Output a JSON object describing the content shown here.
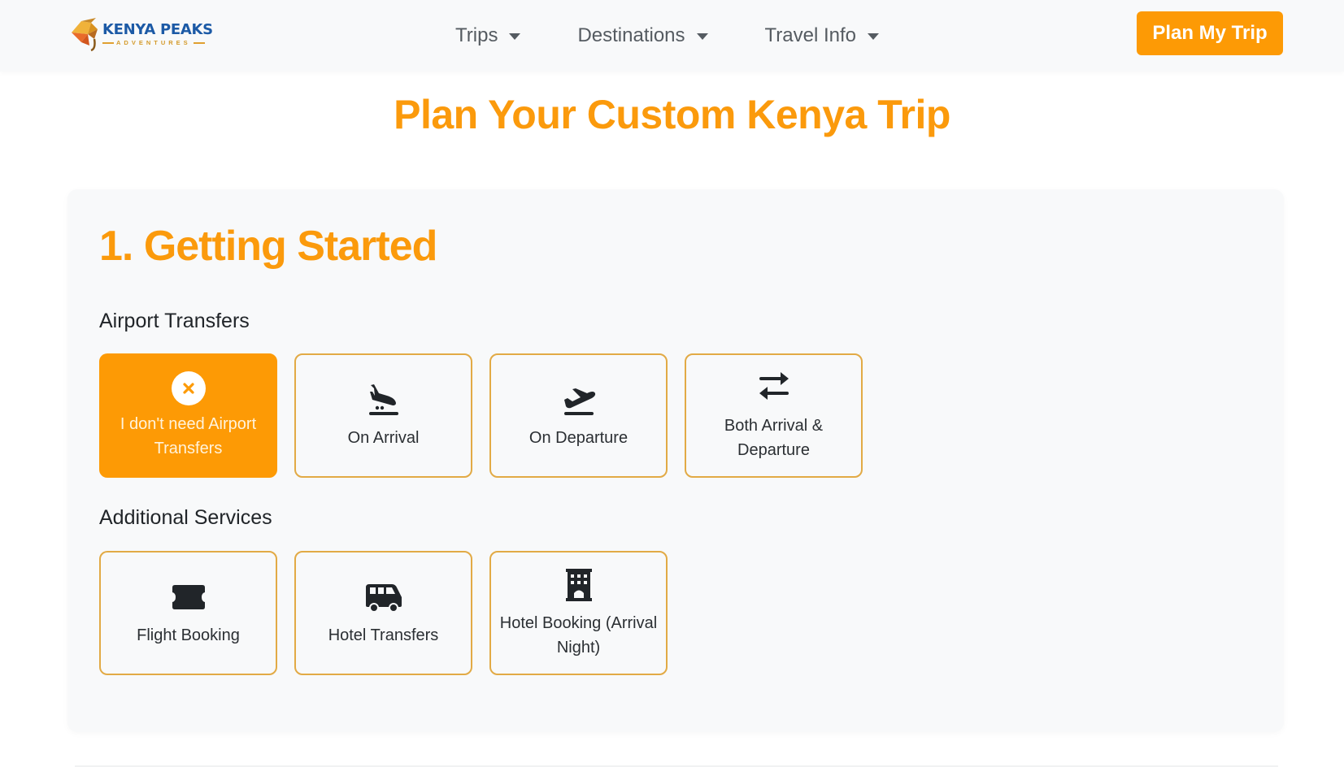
{
  "brand": {
    "name": "KENYA PEAKS",
    "tagline": "ADVENTURES",
    "logo_icon": "elephant-logo-icon"
  },
  "nav": {
    "items": [
      {
        "label": "Trips",
        "icon": "caret-down-icon"
      },
      {
        "label": "Destinations",
        "icon": "caret-down-icon"
      },
      {
        "label": "Travel Info",
        "icon": "caret-down-icon"
      }
    ],
    "cta_label": "Plan My Trip"
  },
  "page": {
    "title": "Plan Your Custom Kenya Trip"
  },
  "section": {
    "title": "1. Getting Started",
    "airport_transfers": {
      "label": "Airport Transfers",
      "options": [
        {
          "label": "I don't need Airport Transfers",
          "icon": "x-circle-icon",
          "selected": true
        },
        {
          "label": "On Arrival",
          "icon": "plane-arrival-icon",
          "selected": false
        },
        {
          "label": "On Departure",
          "icon": "plane-departure-icon",
          "selected": false
        },
        {
          "label": "Both Arrival & Departure",
          "icon": "arrows-exchange-icon",
          "selected": false
        }
      ]
    },
    "additional_services": {
      "label": "Additional Services",
      "options": [
        {
          "label": "Flight Booking",
          "icon": "ticket-icon",
          "selected": false
        },
        {
          "label": "Hotel Transfers",
          "icon": "van-icon",
          "selected": false
        },
        {
          "label": "Hotel Booking (Arrival Night)",
          "icon": "hotel-building-icon",
          "selected": false
        }
      ]
    }
  },
  "colors": {
    "accent": "#fd9a05",
    "title": "#fb9a0c",
    "card_border": "#e2aa45",
    "brand_blue": "#1c5aa6"
  }
}
